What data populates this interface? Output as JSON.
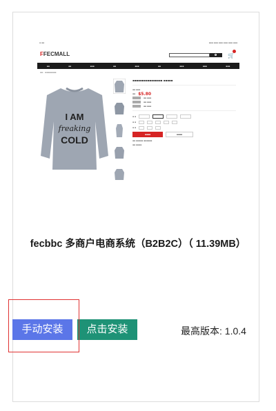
{
  "preview": {
    "logo_mark": "F",
    "logo_text": "FECMALL",
    "shirt_line1": "I AM",
    "shirt_line2": "freaking",
    "shirt_line3": "COLD",
    "price": "$5.80",
    "colors": {
      "shirt": "#9ea6b2",
      "shirt_text": "#1f1f1f",
      "brand_red": "#d62424",
      "nav_bg": "#1b1b1b"
    }
  },
  "product": {
    "title": "fecbbc 多商户电商系统（B2B2C）（ 11.39MB）"
  },
  "actions": {
    "manual_install": "手动安装",
    "click_install": "点击安装"
  },
  "version": {
    "label": "最高版本: 1.0.4"
  },
  "colors": {
    "manual_button": "#5b76e8",
    "click_button": "#1e9276",
    "highlight_border": "#e03131"
  }
}
